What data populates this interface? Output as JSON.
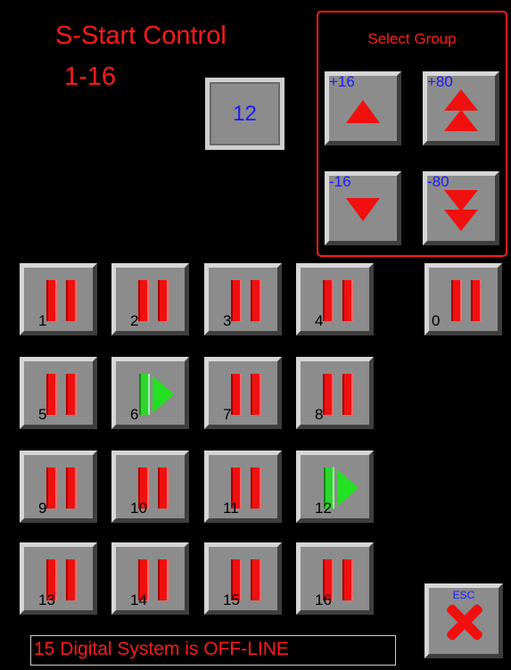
{
  "header": {
    "title_line1": "S-Start Control",
    "title_line2": "1-16",
    "selected_value": "12"
  },
  "select_group": {
    "title": "Select Group",
    "buttons": [
      {
        "label": "+16",
        "icon": "single-up-arrow-icon"
      },
      {
        "label": "+80",
        "icon": "double-up-arrow-icon"
      },
      {
        "label": "-16",
        "icon": "single-down-arrow-icon"
      },
      {
        "label": "-80",
        "icon": "double-down-arrow-icon"
      }
    ]
  },
  "channels": [
    {
      "label": "1",
      "state": "paused"
    },
    {
      "label": "2",
      "state": "paused"
    },
    {
      "label": "3",
      "state": "paused"
    },
    {
      "label": "4",
      "state": "paused"
    },
    {
      "label": "0",
      "state": "paused"
    },
    {
      "label": "5",
      "state": "paused"
    },
    {
      "label": "6",
      "state": "running"
    },
    {
      "label": "7",
      "state": "paused"
    },
    {
      "label": "8",
      "state": "paused"
    },
    {
      "label": "9",
      "state": "paused"
    },
    {
      "label": "10",
      "state": "paused"
    },
    {
      "label": "11",
      "state": "paused"
    },
    {
      "label": "12",
      "state": "running"
    },
    {
      "label": "13",
      "state": "paused"
    },
    {
      "label": "14",
      "state": "paused"
    },
    {
      "label": "15",
      "state": "paused"
    },
    {
      "label": "16",
      "state": "paused"
    }
  ],
  "esc": {
    "label": "ESC",
    "icon": "close-x-icon"
  },
  "status": {
    "message": "15 Digital System is OFF-LINE"
  },
  "colors": {
    "accent_red": "#ff1a1a",
    "label_blue": "#1a1aff",
    "running_green": "#22e022",
    "button_gray": "#8c8c8c",
    "background": "#000000"
  }
}
